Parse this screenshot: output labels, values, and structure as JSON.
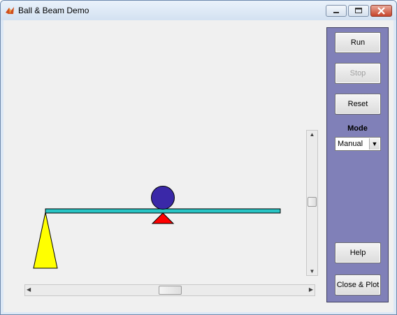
{
  "window": {
    "title": "Ball & Beam Demo"
  },
  "titlebar_buttons": [
    "minimize-icon",
    "maximize-icon",
    "close-icon"
  ],
  "controls": {
    "run_label": "Run",
    "stop_label": "Stop",
    "reset_label": "Reset",
    "mode_label": "Mode",
    "mode_value": "Manual",
    "help_label": "Help",
    "close_plot_label": "Close & Plot"
  },
  "scrollbars": {
    "vertical_value": 0.5,
    "horizontal_value": 0.5
  },
  "colors": {
    "beam": "#28c4c4",
    "ball": "#3a28a8",
    "pivot": "#ff0000",
    "support": "#ffff00",
    "panel": "#8080b8"
  }
}
